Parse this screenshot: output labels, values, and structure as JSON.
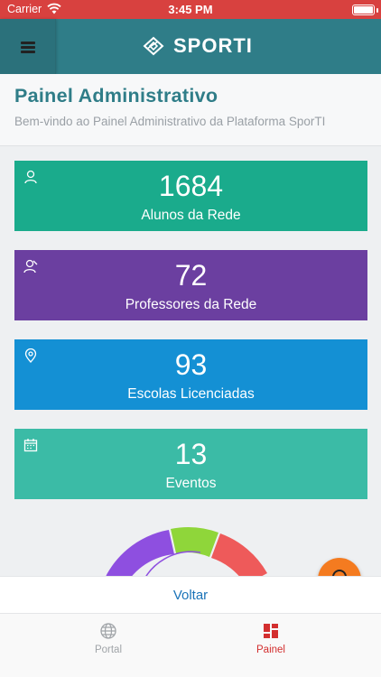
{
  "status_bar": {
    "carrier": "Carrier",
    "time": "3:45 PM"
  },
  "header": {
    "brand": "SPORTI"
  },
  "page": {
    "title": "Painel Administrativo",
    "subtitle": "Bem-vindo ao Painel Administrativo da Plataforma SporTI"
  },
  "cards": [
    {
      "value": "1684",
      "label": "Alunos da Rede",
      "color": "#1aab8c",
      "icon": "user-icon"
    },
    {
      "value": "72",
      "label": "Professores da Rede",
      "color": "#6b3fa0",
      "icon": "teacher-icon"
    },
    {
      "value": "93",
      "label": "Escolas Licenciadas",
      "color": "#1490d4",
      "icon": "location-pin-icon"
    },
    {
      "value": "13",
      "label": "Eventos",
      "color": "#3bbba6",
      "icon": "calendar-icon"
    }
  ],
  "donut_colors": [
    "#8e4fe0",
    "#8fd63a",
    "#ee5a5a"
  ],
  "footer": {
    "back_label": "Voltar"
  },
  "tabs": [
    {
      "label": "Portal",
      "active": false,
      "icon": "globe-icon"
    },
    {
      "label": "Painel",
      "active": true,
      "icon": "dashboard-icon"
    }
  ],
  "colors": {
    "accent": "#2f7d88",
    "active_tab": "#d32f2f",
    "inactive_tab": "#a0a4a8",
    "fab": "#f47b20"
  }
}
